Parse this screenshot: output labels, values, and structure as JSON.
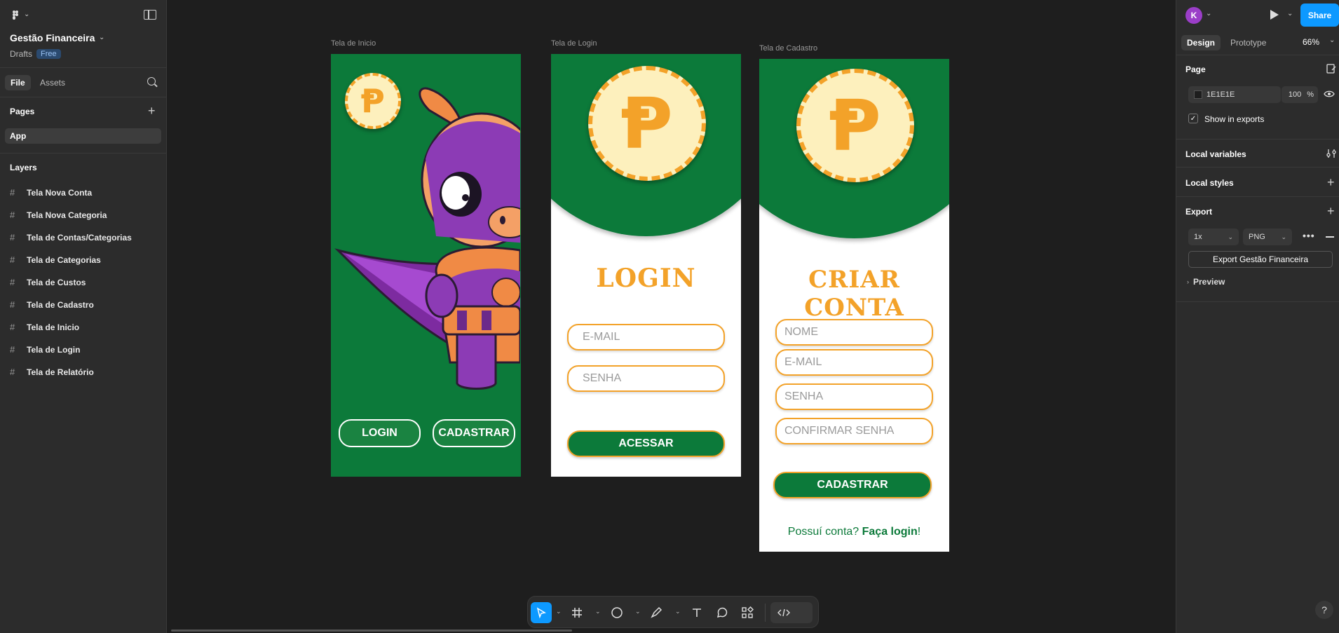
{
  "left_panel": {
    "project_title": "Gestão Financeira",
    "location": "Drafts",
    "plan_badge": "Free",
    "tabs": [
      {
        "label": "File"
      },
      {
        "label": "Assets"
      }
    ],
    "pages_title": "Pages",
    "pages": [
      {
        "label": "App"
      }
    ],
    "layers_title": "Layers",
    "layers": [
      {
        "label": "Tela Nova Conta"
      },
      {
        "label": "Tela Nova Categoria"
      },
      {
        "label": "Tela de Contas/Categorias"
      },
      {
        "label": "Tela de Categorias"
      },
      {
        "label": "Tela de Custos"
      },
      {
        "label": "Tela de Cadastro"
      },
      {
        "label": "Tela de Inicio"
      },
      {
        "label": "Tela de Login"
      },
      {
        "label": "Tela de Relatório"
      }
    ]
  },
  "canvas": {
    "frames": {
      "inicio": {
        "label": "Tela de Inicio",
        "login_button": "LOGIN",
        "register_button": "CADASTRAR"
      },
      "login": {
        "label": "Tela de Login",
        "title": "LOGIN",
        "email_placeholder": "E-MAIL",
        "password_placeholder": "SENHA",
        "submit_button": "ACESSAR"
      },
      "cadastro": {
        "label": "Tela de Cadastro",
        "title": "CRIAR CONTA",
        "name_placeholder": "NOME",
        "email_placeholder": "E-MAIL",
        "password_placeholder": "SENHA",
        "confirm_placeholder": "CONFIRMAR SENHA",
        "submit_button": "CADASTRAR",
        "footer_text": "Possuí conta? ",
        "footer_link": "Faça login",
        "footer_end": "!"
      }
    },
    "coin_symbol": "Ᵽ",
    "colors": {
      "brand_green": "#0c7a3a",
      "accent_orange": "#f3a229",
      "coin_fill": "#fdf0bd",
      "canvas_bg": "#1e1e1e"
    }
  },
  "toolbar": {
    "tools": [
      "move-icon",
      "frame-icon",
      "ellipse-icon",
      "pen-icon",
      "text-icon",
      "comment-icon",
      "actions-icon",
      "dev-mode-icon"
    ]
  },
  "right_panel": {
    "avatar_initial": "K",
    "share_label": "Share",
    "tabs": [
      {
        "label": "Design"
      },
      {
        "label": "Prototype"
      }
    ],
    "zoom": "66%",
    "page_section": "Page",
    "bg_color": "1E1E1E",
    "bg_opacity": "100",
    "percent": "%",
    "show_in_exports": "Show in exports",
    "local_variables": "Local variables",
    "local_styles": "Local styles",
    "export_section": "Export",
    "export_scale": "1x",
    "export_format": "PNG",
    "export_button": "Export Gestão Financeira",
    "preview": "Preview"
  }
}
